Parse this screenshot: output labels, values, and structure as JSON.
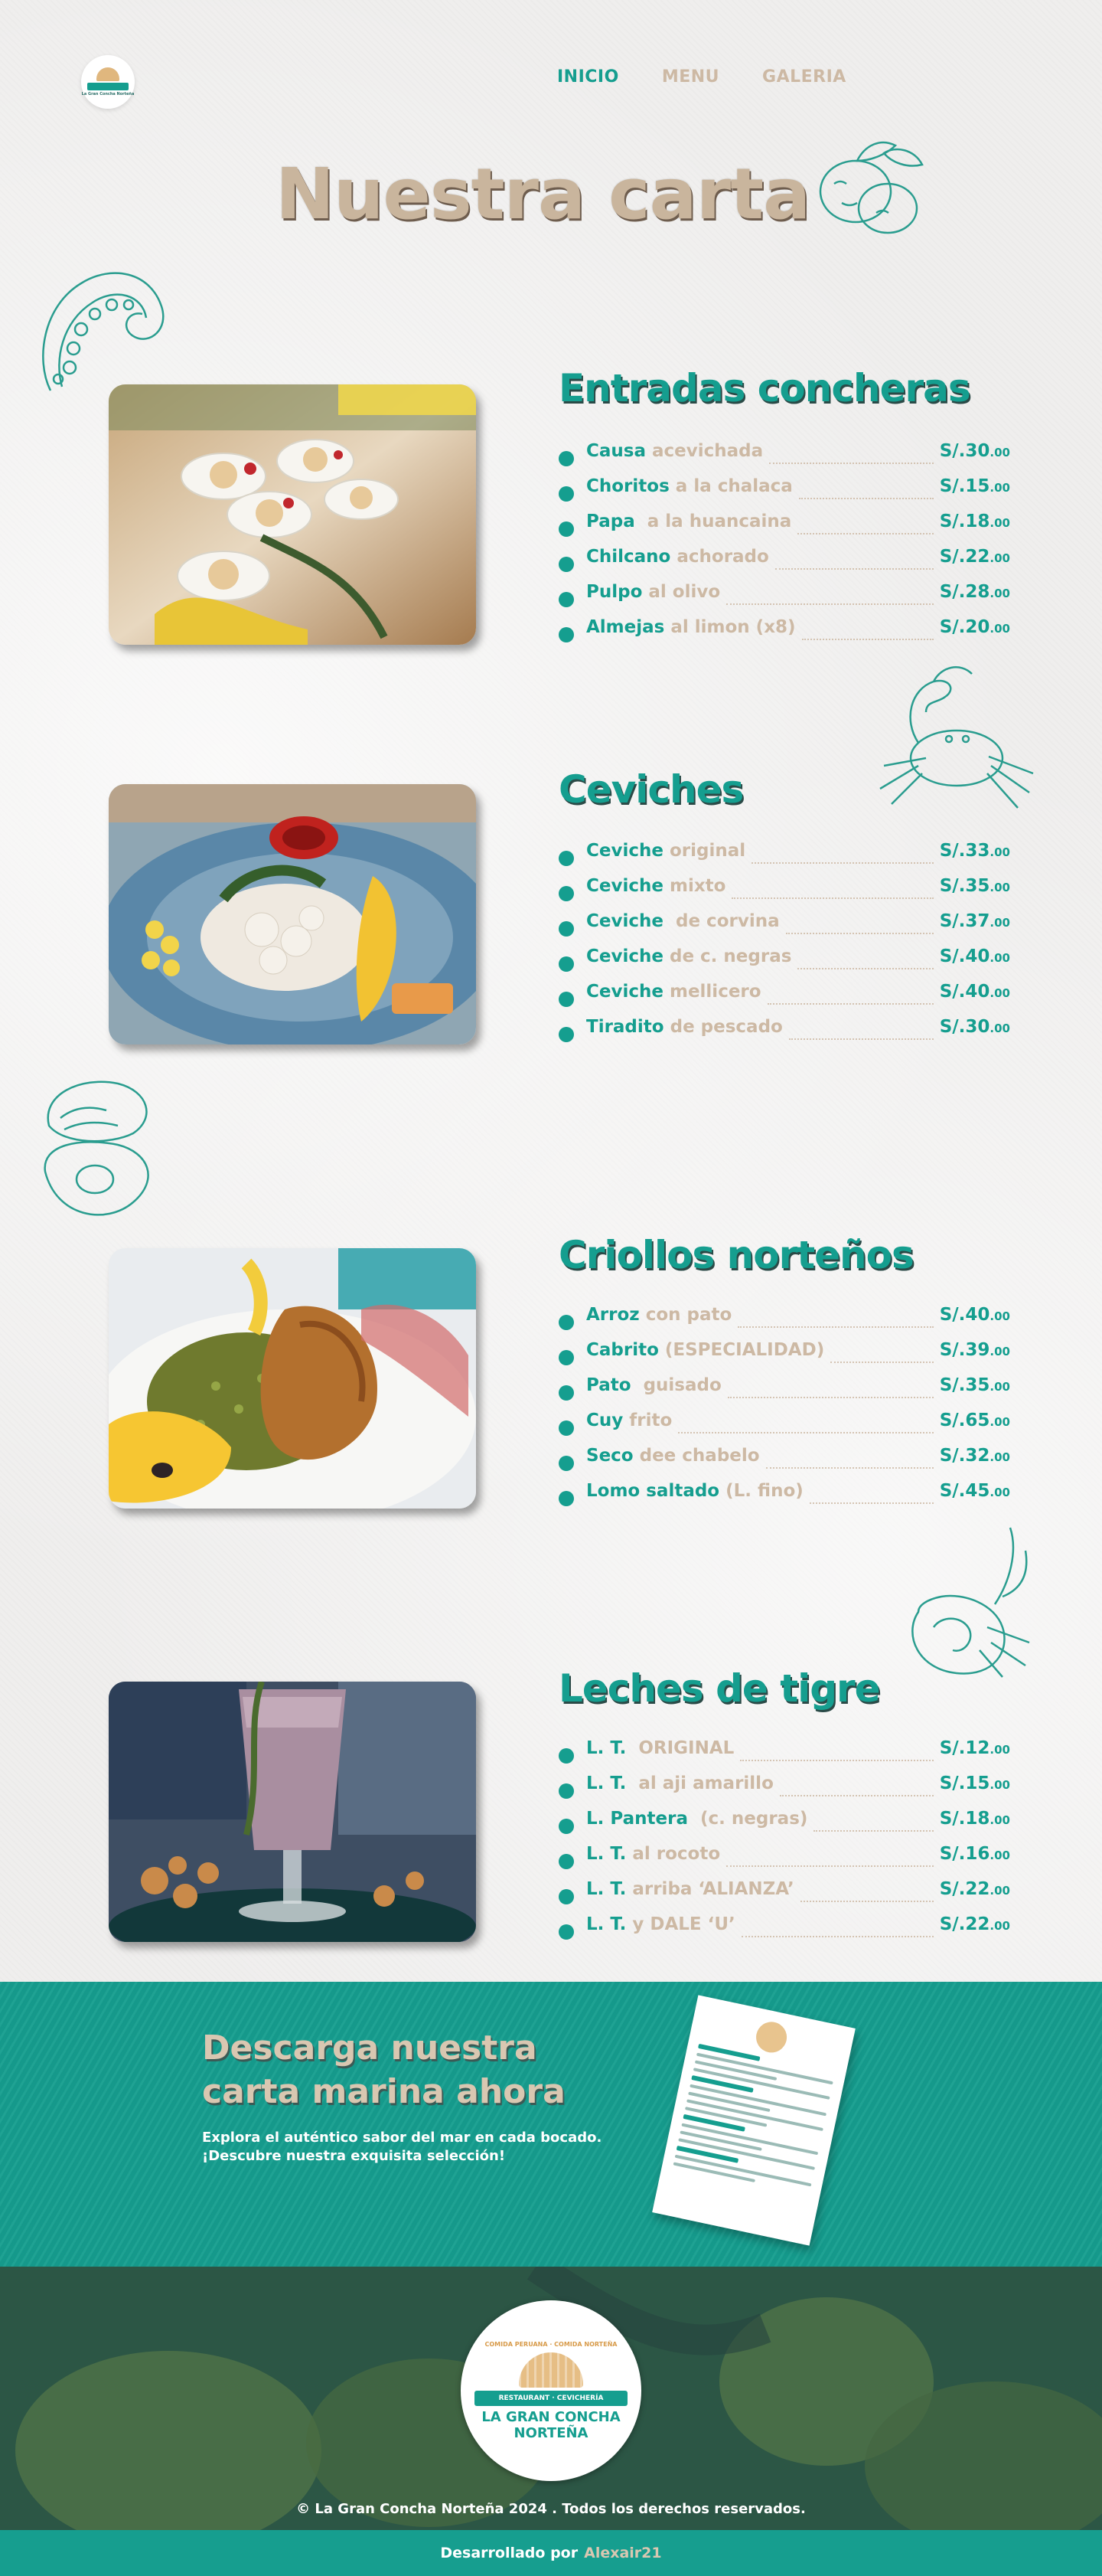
{
  "nav": {
    "logo_alt": "La Gran Concha Norteña",
    "items": [
      {
        "label": "INICIO",
        "active": true
      },
      {
        "label": "MENU",
        "active": false
      },
      {
        "label": "GALERIA",
        "active": false
      }
    ]
  },
  "page_title": "Nuestra carta",
  "colors": {
    "teal": "#159e8f",
    "tan": "#cdb9a4",
    "background": "#efeeed"
  },
  "sections": [
    {
      "title": "Entradas concheras",
      "image": "ceviche-spoons-photo",
      "items": [
        {
          "name": "Causa",
          "desc": " acevichada",
          "price": "S/.30",
          "cents": ".00"
        },
        {
          "name": "Choritos",
          "desc": " a la chalaca",
          "price": "S/.15",
          "cents": ".00"
        },
        {
          "name": "Papa",
          "desc": "  a la huancaina",
          "price": "S/.18",
          "cents": ".00"
        },
        {
          "name": "Chilcano",
          "desc": " achorado",
          "price": "S/.22",
          "cents": ".00"
        },
        {
          "name": "Pulpo",
          "desc": " al olivo",
          "price": "S/.28",
          "cents": ".00"
        },
        {
          "name": "Almejas",
          "desc": " al limon (x8)",
          "price": "S/.20",
          "cents": ".00"
        }
      ]
    },
    {
      "title": "Ceviches",
      "image": "ceviche-plate-photo",
      "items": [
        {
          "name": "Ceviche",
          "desc": " original",
          "price": "S/.33",
          "cents": ".00"
        },
        {
          "name": "Ceviche",
          "desc": " mixto",
          "price": "S/.35",
          "cents": ".00"
        },
        {
          "name": "Ceviche",
          "desc": "  de corvina",
          "price": "S/.37",
          "cents": ".00"
        },
        {
          "name": "Ceviche",
          "desc": " de c. negras",
          "price": "S/.40",
          "cents": ".00"
        },
        {
          "name": "Ceviche",
          "desc": " mellicero",
          "price": "S/.40",
          "cents": ".00"
        },
        {
          "name": "Tiradito",
          "desc": " de pescado",
          "price": "S/.30",
          "cents": ".00"
        }
      ]
    },
    {
      "title": "Criollos norteños",
      "image": "arroz-con-pato-photo",
      "items": [
        {
          "name": "Arroz",
          "desc": " con pato",
          "price": "S/.40",
          "cents": ".00"
        },
        {
          "name": "Cabrito",
          "desc": " (ESPECIALIDAD)",
          "price": "S/.39",
          "cents": ".00"
        },
        {
          "name": "Pato",
          "desc": "  guisado",
          "price": "S/.35",
          "cents": ".00"
        },
        {
          "name": "Cuy",
          "desc": " frito",
          "price": "S/.65",
          "cents": ".00"
        },
        {
          "name": "Seco",
          "desc": " dee chabelo",
          "price": "S/.32",
          "cents": ".00"
        },
        {
          "name": "Lomo saltado",
          "desc": " (L. fino)",
          "price": "S/.45",
          "cents": ".00"
        }
      ]
    },
    {
      "title": "Leches de tigre",
      "image": "leche-de-tigre-photo",
      "items": [
        {
          "name": "L. T.",
          "desc": "  ORIGINAL",
          "price": "S/.12",
          "cents": ".00"
        },
        {
          "name": "L. T.",
          "desc": "  al aji amarillo",
          "price": "S/.15",
          "cents": ".00"
        },
        {
          "name": "L. Pantera",
          "desc": "  (c. negras)",
          "price": "S/.18",
          "cents": ".00"
        },
        {
          "name": "L. T.",
          "desc": " al rocoto",
          "price": "S/.16",
          "cents": ".00"
        },
        {
          "name": "L. T.",
          "desc": " arriba ‘ALIANZA’",
          "price": "S/.22",
          "cents": ".00"
        },
        {
          "name": "L. T.",
          "desc": " y DALE ‘U’",
          "price": "S/.22",
          "cents": ".00"
        }
      ]
    }
  ],
  "download": {
    "title_line1": "Descarga nuestra",
    "title_line2": "carta marina ahora",
    "sub_line1": "Explora el auténtico sabor del mar en cada bocado.",
    "sub_line2": "¡Descubre nuestra exquisita selección!"
  },
  "footer": {
    "logo_arc": "COMIDA PERUANA · COMIDA NORTEÑA",
    "logo_band": "RESTAURANT · CEVICHERÍA",
    "logo_brand1": "LA GRAN CONCHA",
    "logo_brand2": "NORTEÑA",
    "copyright": "© La Gran Concha Norteña 2024 . Todos los derechos reservados.",
    "dev_prefix": "Desarrollado por",
    "dev_name": "Alexair21"
  },
  "icons": [
    "octopus-icon",
    "lemon-icon",
    "crab-icon",
    "clam-icon",
    "hermit-crab-icon"
  ]
}
